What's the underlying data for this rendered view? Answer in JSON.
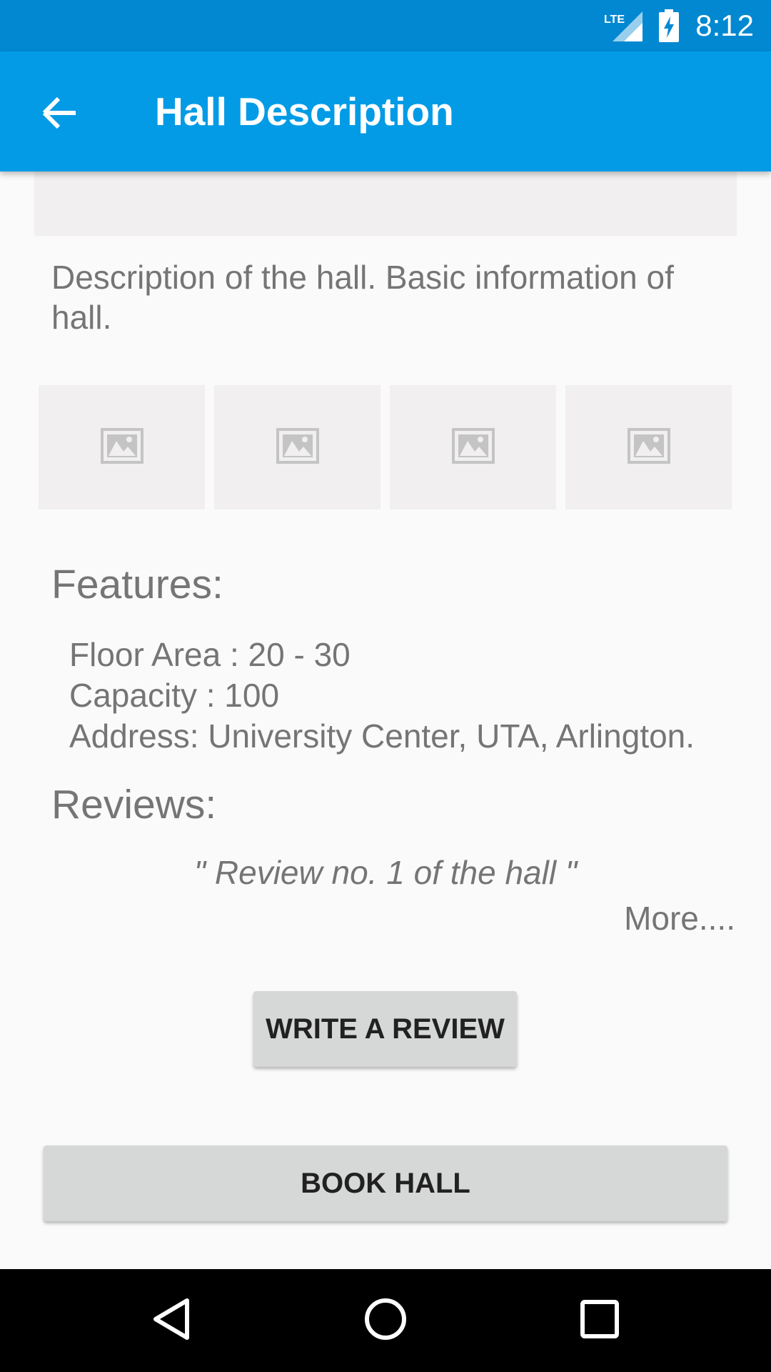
{
  "status_bar": {
    "network_label": "LTE",
    "time": "8:12",
    "icons": [
      "lte-signal-icon",
      "battery-charging-icon"
    ]
  },
  "app_bar": {
    "title": "Hall Description",
    "back_icon": "arrow-back-icon"
  },
  "hall": {
    "description": "Description of the hall. Basic information of hall.",
    "thumbnails": [
      "image-placeholder-icon",
      "image-placeholder-icon",
      "image-placeholder-icon",
      "image-placeholder-icon"
    ]
  },
  "features": {
    "heading": "Features:",
    "items": [
      "Floor Area : 20 - 30",
      "Capacity : 100",
      "Address: University Center, UTA, Arlington."
    ]
  },
  "reviews": {
    "heading": "Reviews:",
    "first_review": "\" Review no. 1 of the hall \"",
    "more_label": "More...."
  },
  "actions": {
    "write_review_label": "WRITE A REVIEW",
    "book_hall_label": "BOOK HALL"
  },
  "nav_bar": {
    "icons": [
      "back-triangle-icon",
      "home-circle-icon",
      "recents-square-icon"
    ]
  },
  "colors": {
    "status_bar": "#0288d1",
    "app_bar": "#039be5",
    "button": "#d6d7d7",
    "placeholder": "#f1eff0",
    "text_secondary": "#757575"
  }
}
